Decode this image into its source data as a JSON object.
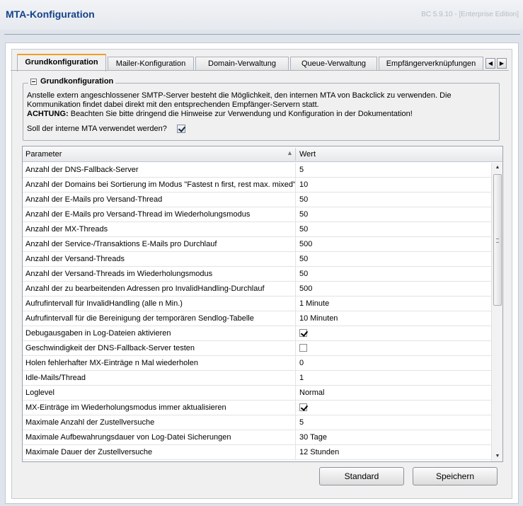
{
  "app": {
    "title": "MTA-Konfiguration",
    "version": "BC 5.9.10 - [Enterprise Edition]"
  },
  "tabs": [
    {
      "label": "Grundkonfiguration",
      "active": true
    },
    {
      "label": "Mailer-Konfiguration",
      "active": false
    },
    {
      "label": "Domain-Verwaltung",
      "active": false
    },
    {
      "label": "Queue-Verwaltung",
      "active": false
    },
    {
      "label": "Empfängerverknüpfungen",
      "active": false
    }
  ],
  "section": {
    "legend": "Grundkonfiguration",
    "info_line1": "Anstelle extern angeschlossener SMTP-Server besteht die Möglichkeit, den internen MTA von Backclick zu verwenden. Die Kommunikation findet dabei direkt mit den entsprechenden Empfänger-Servern statt.",
    "warning_label": "ACHTUNG:",
    "warning_text": " Beachten Sie bitte dringend die Hinweise zur Verwendung und Konfiguration in der Dokumentation!",
    "question": "Soll der interne MTA verwendet werden?",
    "use_internal_mta": true
  },
  "grid": {
    "columns": [
      "Parameter",
      "Wert"
    ],
    "rows": [
      {
        "param": "Anzahl der DNS-Fallback-Server",
        "value": "5"
      },
      {
        "param": "Anzahl der Domains bei Sortierung im Modus \"Fastest n first, rest max. mixed\"",
        "value": "10"
      },
      {
        "param": "Anzahl der E-Mails pro Versand-Thread",
        "value": "50"
      },
      {
        "param": "Anzahl der E-Mails pro Versand-Thread im Wiederholungsmodus",
        "value": "50"
      },
      {
        "param": "Anzahl der MX-Threads",
        "value": "50"
      },
      {
        "param": "Anzahl der Service-/Transaktions E-Mails pro Durchlauf",
        "value": "500"
      },
      {
        "param": "Anzahl der Versand-Threads",
        "value": "50"
      },
      {
        "param": "Anzahl der Versand-Threads im Wiederholungsmodus",
        "value": "50"
      },
      {
        "param": "Anzahl der zu bearbeitenden Adressen pro InvalidHandling-Durchlauf",
        "value": "500"
      },
      {
        "param": "Aufrufintervall für InvalidHandling (alle n Min.)",
        "value": "1 Minute"
      },
      {
        "param": "Aufrufintervall für die Bereinigung der temporären Sendlog-Tabelle",
        "value": "10 Minuten"
      },
      {
        "param": "Debugausgaben in Log-Dateien aktivieren",
        "checkbox": true,
        "checked": true
      },
      {
        "param": "Geschwindigkeit der DNS-Fallback-Server testen",
        "checkbox": true,
        "checked": false
      },
      {
        "param": "Holen fehlerhafter MX-Einträge n Mal wiederholen",
        "value": "0"
      },
      {
        "param": "Idle-Mails/Thread",
        "value": "1"
      },
      {
        "param": "Loglevel",
        "value": "Normal"
      },
      {
        "param": "MX-Einträge im Wiederholungsmodus immer aktualisieren",
        "checkbox": true,
        "checked": true
      },
      {
        "param": "Maximale Anzahl der Zustellversuche",
        "value": "5"
      },
      {
        "param": "Maximale Aufbewahrungsdauer von Log-Datei Sicherungen",
        "value": "30 Tage"
      },
      {
        "param": "Maximale Dauer der Zustellversuche",
        "value": "12 Stunden"
      }
    ]
  },
  "buttons": {
    "standard": "Standard",
    "save": "Speichern"
  },
  "icons": {
    "sort": "sort-asc-icon",
    "scroll_up": "arrow-up-icon",
    "scroll_down": "arrow-down-icon",
    "tab_left": "arrow-left-icon",
    "tab_right": "arrow-right-icon"
  },
  "colors": {
    "title": "#15428b",
    "active_tab_accent": "#f0a020"
  }
}
